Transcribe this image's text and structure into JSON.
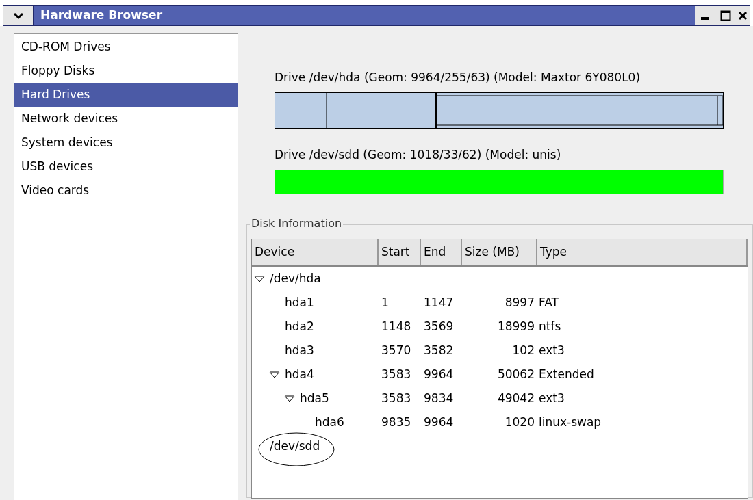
{
  "window": {
    "title": "Hardware Browser"
  },
  "sidebar": {
    "items": [
      {
        "label": "CD-ROM Drives",
        "selected": false
      },
      {
        "label": "Floppy Disks",
        "selected": false
      },
      {
        "label": "Hard Drives",
        "selected": true
      },
      {
        "label": "Network devices",
        "selected": false
      },
      {
        "label": "System devices",
        "selected": false
      },
      {
        "label": "USB devices",
        "selected": false
      },
      {
        "label": "Video cards",
        "selected": false
      }
    ]
  },
  "drives": [
    {
      "label": "Drive /dev/hda (Geom: 9964/255/63) (Model: Maxtor 6Y080L0)",
      "kind": "partitioned"
    },
    {
      "label": "Drive /dev/sdd (Geom: 1018/33/62) (Model: unis)",
      "kind": "free"
    }
  ],
  "disk_information": {
    "title": "Disk Information",
    "columns": [
      "Device",
      "Start",
      "End",
      "Size (MB)",
      "Type"
    ],
    "rows": [
      {
        "device": "/dev/hda",
        "expanded": true,
        "children": [
          {
            "device": "hda1",
            "start": "1",
            "end": "1147",
            "size": "8997",
            "type": "FAT"
          },
          {
            "device": "hda2",
            "start": "1148",
            "end": "3569",
            "size": "18999",
            "type": "ntfs"
          },
          {
            "device": "hda3",
            "start": "3570",
            "end": "3582",
            "size": "102",
            "type": "ext3"
          },
          {
            "device": "hda4",
            "start": "3583",
            "end": "9964",
            "size": "50062",
            "type": "Extended",
            "expanded": true,
            "children": [
              {
                "device": "hda5",
                "start": "3583",
                "end": "9834",
                "size": "49042",
                "type": "ext3",
                "expanded": true,
                "children": [
                  {
                    "device": "hda6",
                    "start": "9835",
                    "end": "9964",
                    "size": "1020",
                    "type": "linux-swap"
                  }
                ]
              }
            ]
          }
        ]
      },
      {
        "device": "/dev/sdd",
        "circled": true
      }
    ]
  }
}
